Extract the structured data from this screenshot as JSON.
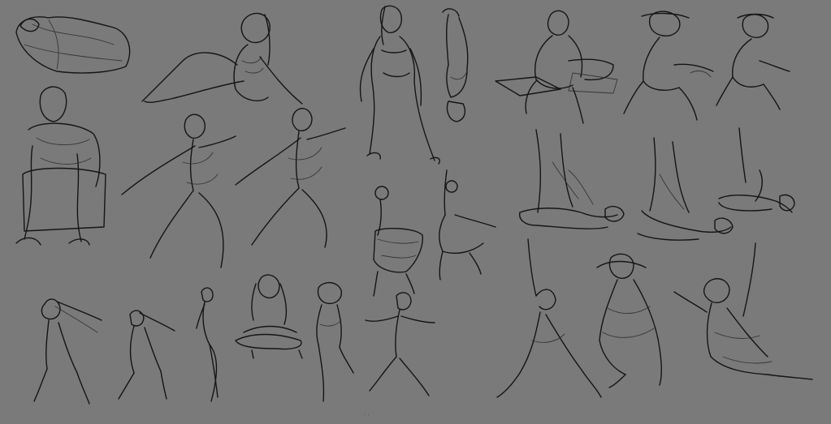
{
  "sheet": {
    "title": "",
    "background": "#7a7a7a",
    "ink": "#151515",
    "figures": [
      {
        "name": "figure-curled-lying"
      },
      {
        "name": "figure-seated-reclining"
      },
      {
        "name": "figure-seated-chair"
      },
      {
        "name": "figure-lunge-left"
      },
      {
        "name": "figure-lunge-right"
      },
      {
        "name": "figure-standing-swimsuit"
      },
      {
        "name": "figure-upside-down"
      },
      {
        "name": "figure-seated-bench"
      },
      {
        "name": "figure-crouch-hat-1"
      },
      {
        "name": "figure-crouch-hat-2"
      },
      {
        "name": "figure-hanging-ring-1"
      },
      {
        "name": "figure-hanging-ring-2"
      },
      {
        "name": "figure-aerial-silk-1"
      },
      {
        "name": "figure-aerial-silk-2"
      },
      {
        "name": "figure-aerial-silk-3"
      },
      {
        "name": "figure-windblown-1"
      },
      {
        "name": "figure-windblown-2"
      },
      {
        "name": "figure-arched-dancer"
      },
      {
        "name": "figure-seated-cross-legged"
      },
      {
        "name": "figure-standing-hat"
      },
      {
        "name": "figure-striding"
      },
      {
        "name": "figure-sword-lunge"
      },
      {
        "name": "figure-caped-warrior"
      },
      {
        "name": "figure-swinging-rope"
      }
    ]
  },
  "footer_mark": "· ·"
}
